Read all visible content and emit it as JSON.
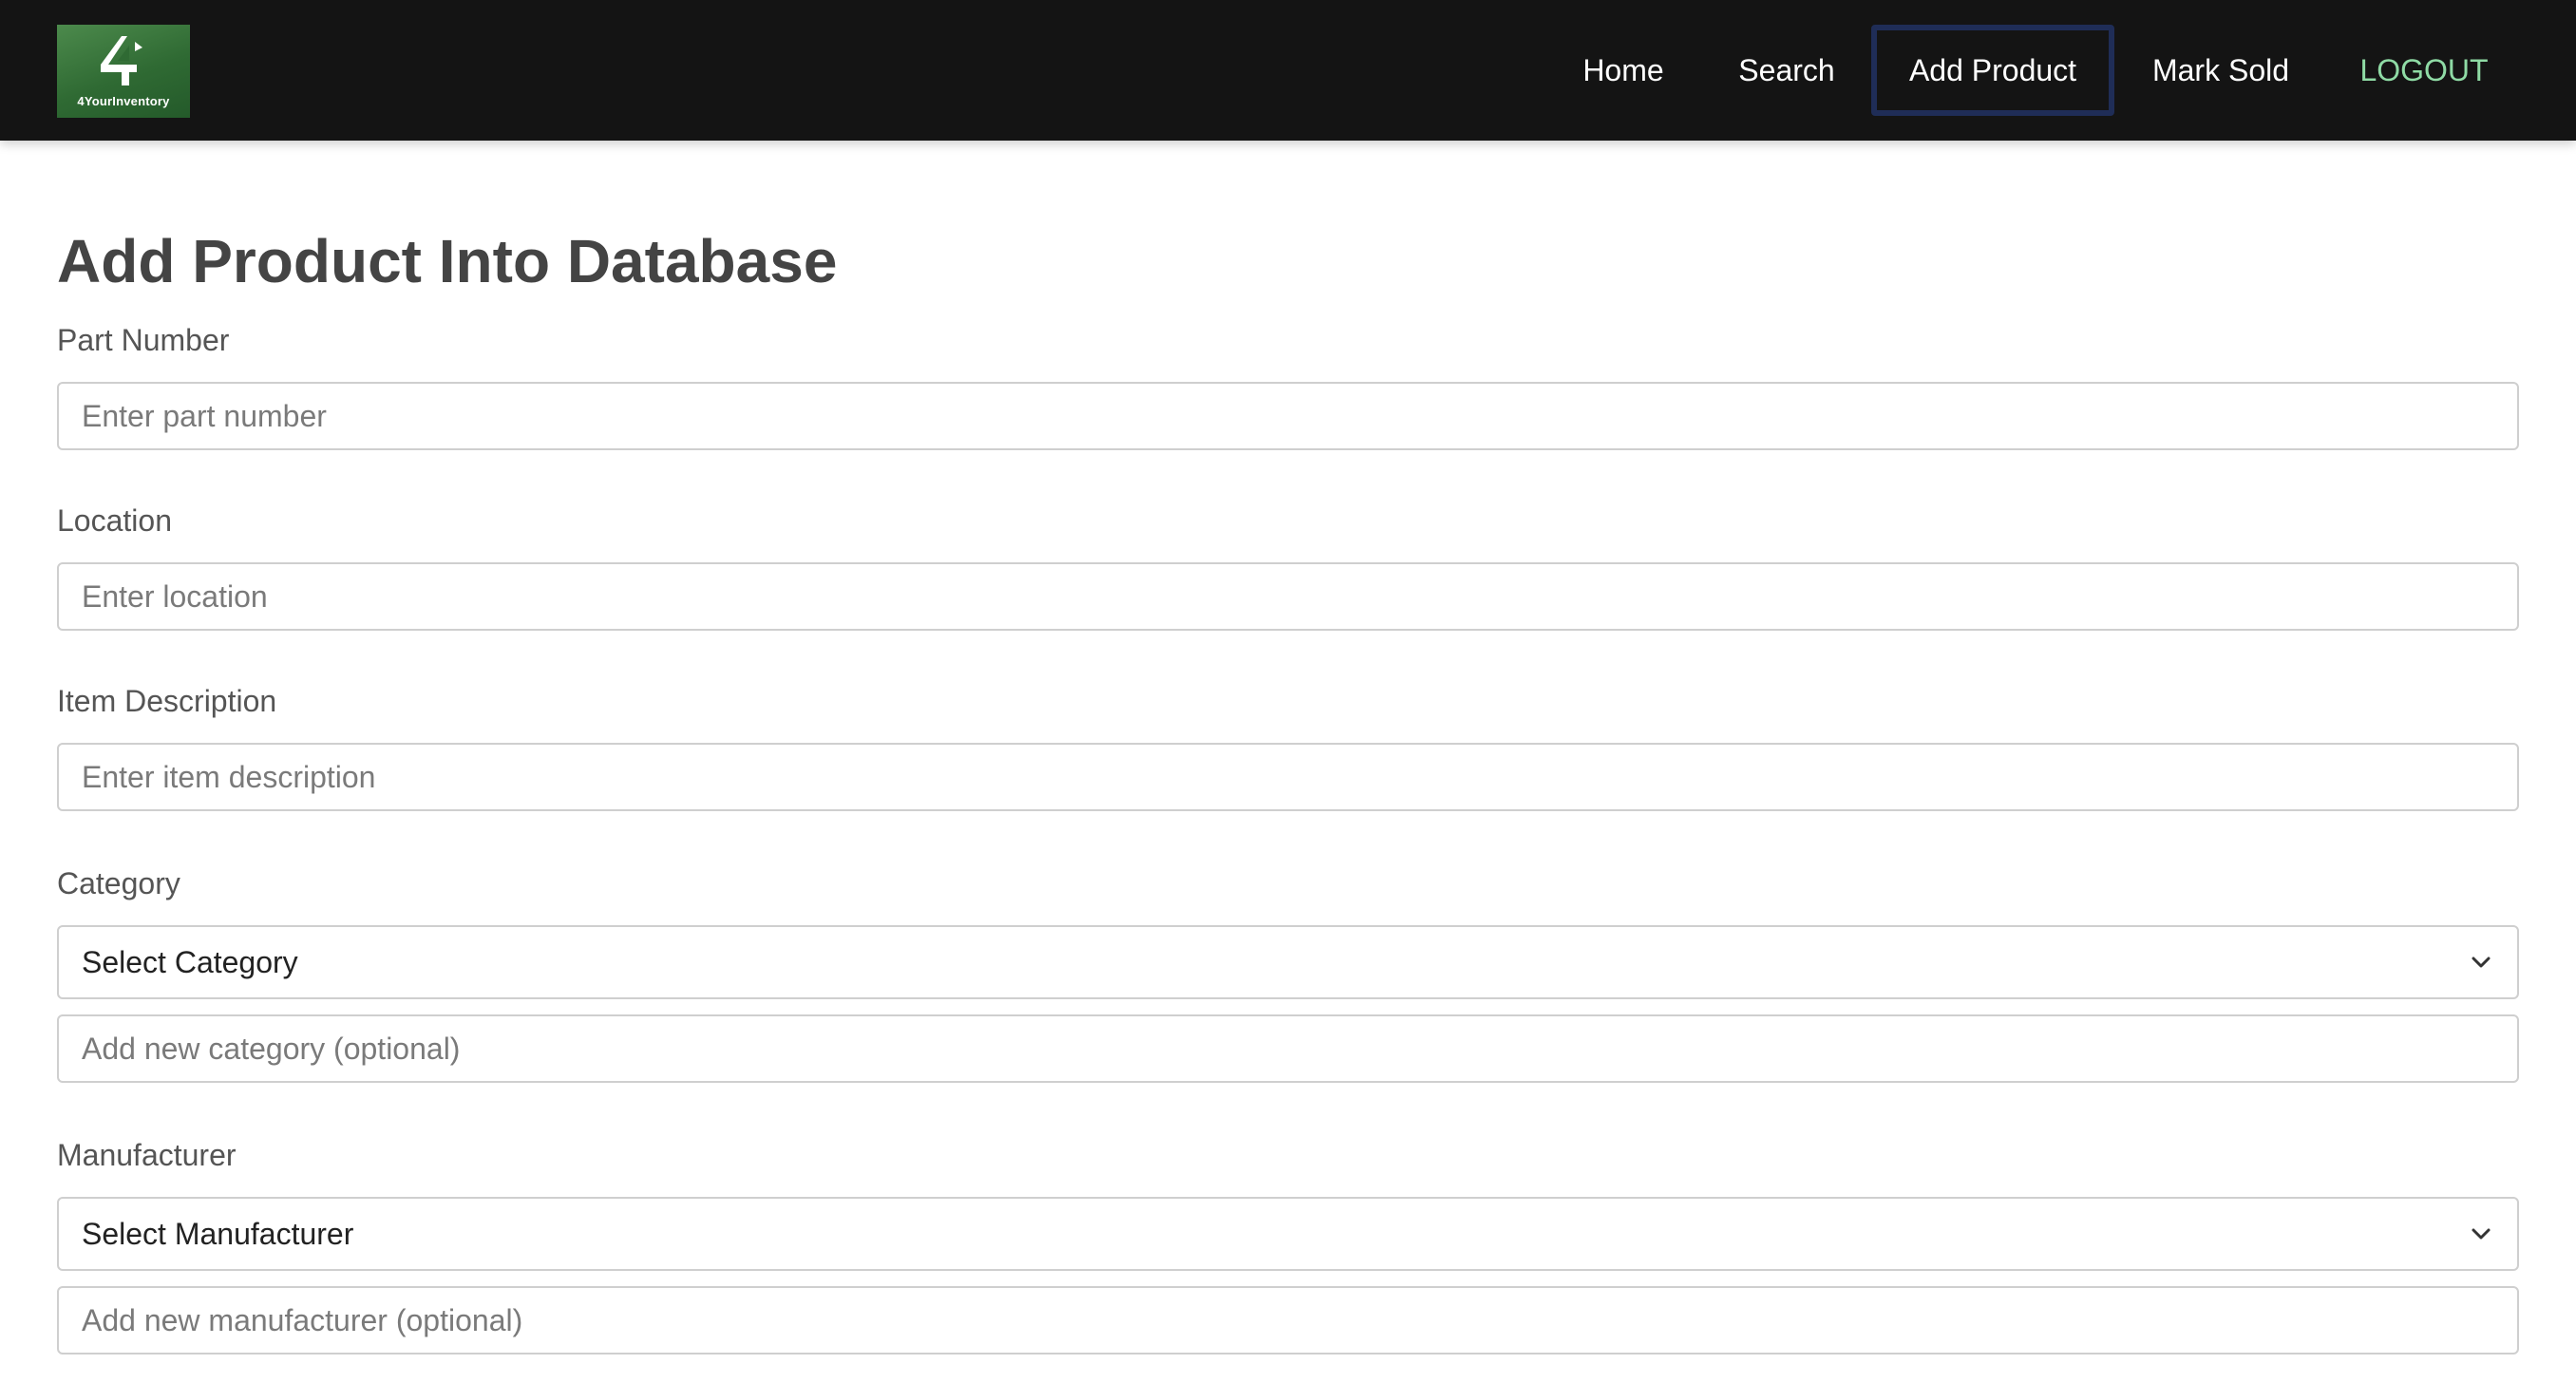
{
  "app": {
    "logo_text": "4YourInventory"
  },
  "nav": {
    "home": "Home",
    "search": "Search",
    "add_product": "Add Product",
    "mark_sold": "Mark Sold",
    "logout": "LOGOUT"
  },
  "page": {
    "title": "Add Product Into Database"
  },
  "form": {
    "part_number": {
      "label": "Part Number",
      "placeholder": "Enter part number",
      "value": ""
    },
    "location": {
      "label": "Location",
      "placeholder": "Enter location",
      "value": ""
    },
    "item_description": {
      "label": "Item Description",
      "placeholder": "Enter item description",
      "value": ""
    },
    "category": {
      "label": "Category",
      "selected": "Select Category",
      "new_placeholder": "Add new category (optional)"
    },
    "manufacturer": {
      "label": "Manufacturer",
      "selected": "Select Manufacturer",
      "new_placeholder": "Add new manufacturer (optional)"
    }
  },
  "icons": {
    "logo": "four-logo-icon",
    "dropdown": "chevron-down-icon"
  },
  "colors": {
    "navbar_bg": "#141414",
    "active_border": "#1f2d57",
    "logout_text": "#8fdba5",
    "logo_bg": "#2f6a33"
  }
}
